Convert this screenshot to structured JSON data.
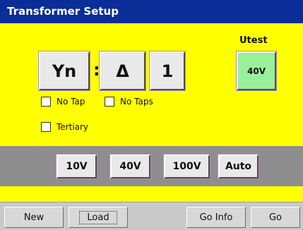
{
  "window": {
    "title": "Transformer Setup"
  },
  "vector_group": {
    "primary": "Yn",
    "separator": ":",
    "secondary": "Δ",
    "phase_shift": "1"
  },
  "options": {
    "no_tap": {
      "label": "No Tap",
      "checked": false
    },
    "no_taps": {
      "label": "No Taps",
      "checked": false
    },
    "tertiary": {
      "label": "Tertiary",
      "checked": false
    }
  },
  "utest": {
    "label": "Utest",
    "value": "40V",
    "color": "#9af09a"
  },
  "voltages": {
    "items": [
      "10V",
      "40V",
      "100V",
      "Auto"
    ]
  },
  "toolbar": {
    "new": "New",
    "load": "Load",
    "go_info": "Go Info",
    "go": "Go"
  },
  "colors": {
    "title_bg": "#0b2d97",
    "content_bg": "#ffff00",
    "band_bg": "#8e8e8e",
    "bar_bg": "#c9c9c9"
  }
}
